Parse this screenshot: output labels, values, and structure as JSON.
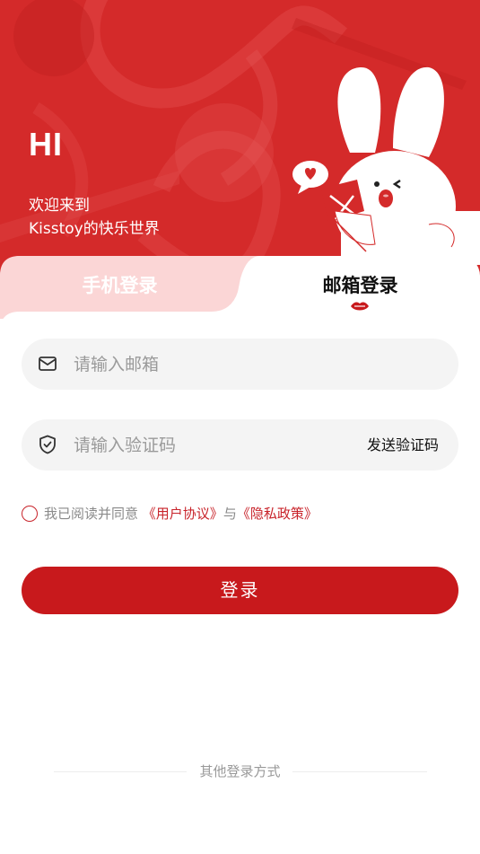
{
  "hero": {
    "greeting": "HI",
    "welcome_line1": "欢迎来到",
    "welcome_line2": "Kisstoy的快乐世界",
    "mascot": "rabbit-mascot-with-heart-bubble"
  },
  "tabs": [
    {
      "label": "手机登录",
      "active": false
    },
    {
      "label": "邮箱登录",
      "active": true
    }
  ],
  "form": {
    "email_placeholder": "请输入邮箱",
    "email_icon": "mail-icon",
    "code_placeholder": "请输入验证码",
    "code_icon": "shield-check-icon",
    "send_code_label": "发送验证码"
  },
  "agreement": {
    "prefix": "我已阅读并同意",
    "user_agreement": "《用户协议》",
    "and": "与",
    "privacy_policy": "《隐私政策》",
    "checked": false
  },
  "login_button": "登录",
  "other_login": "其他登录方式",
  "colors": {
    "brand_red": "#c8191c",
    "hero_red": "#d42a2a",
    "tab_inactive_bg": "#fbd6d6",
    "field_bg": "#f4f4f4"
  }
}
